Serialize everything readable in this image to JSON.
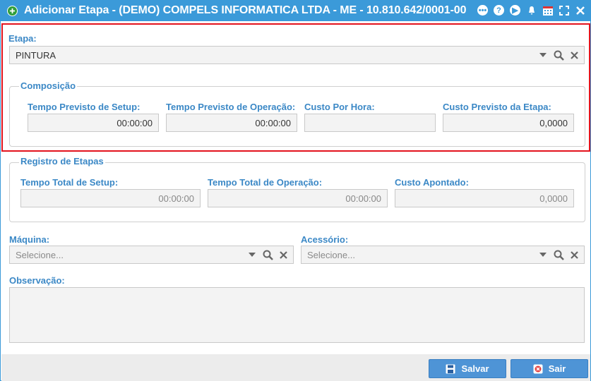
{
  "window": {
    "title": "Adicionar Etapa - (DEMO) COMPELS INFORMATICA LTDA - ME - 10.810.642/0001-00",
    "title_icon": "add-circle-icon",
    "toolbar_icons": [
      "chat-icon",
      "help-icon",
      "play-icon",
      "bell-icon",
      "calendar-icon",
      "fullscreen-icon",
      "close-icon"
    ]
  },
  "etapa": {
    "label": "Etapa:",
    "value": "PINTURA"
  },
  "composicao": {
    "legend": "Composição",
    "setup_label": "Tempo Previsto de Setup:",
    "setup_value": "00:00:00",
    "operacao_label": "Tempo Previsto de Operação:",
    "operacao_value": "00:00:00",
    "custo_hora_label": "Custo Por Hora:",
    "custo_hora_value": "",
    "custo_etapa_label": "Custo Previsto da Etapa:",
    "custo_etapa_value": "0,0000"
  },
  "registro": {
    "legend": "Registro de Etapas",
    "setup_label": "Tempo Total de Setup:",
    "setup_value": "00:00:00",
    "operacao_label": "Tempo Total de Operação:",
    "operacao_value": "00:00:00",
    "custo_label": "Custo Apontado:",
    "custo_value": "0,0000"
  },
  "maquina": {
    "label": "Máquina:",
    "placeholder": "Selecione..."
  },
  "acessorio": {
    "label": "Acessório:",
    "placeholder": "Selecione..."
  },
  "observacao": {
    "label": "Observação:",
    "value": ""
  },
  "footer": {
    "save_label": "Salvar",
    "exit_label": "Sair"
  },
  "colors": {
    "titlebar": "#3b9ad9",
    "label": "#3b88c6",
    "highlight_border": "#e3131d",
    "button": "#4e94d6"
  }
}
